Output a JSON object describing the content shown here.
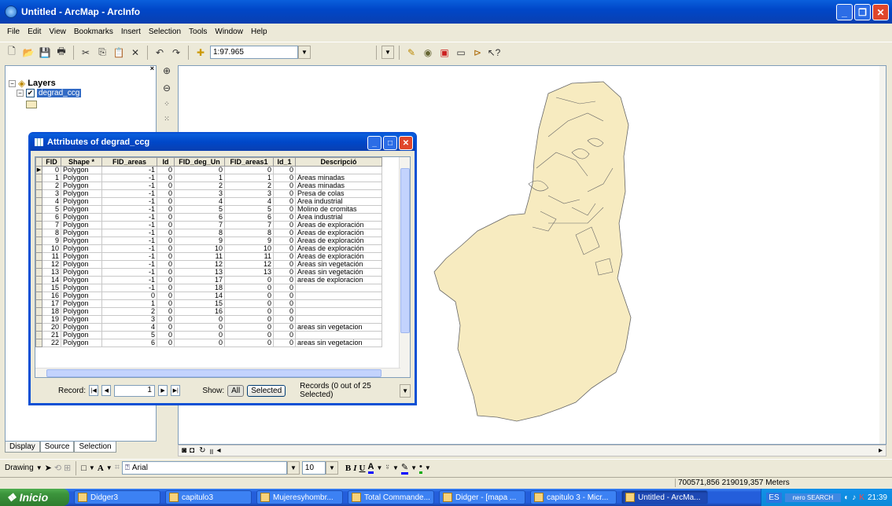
{
  "window": {
    "title": "Untitled - ArcMap - ArcInfo"
  },
  "menu": [
    "File",
    "Edit",
    "View",
    "Bookmarks",
    "Insert",
    "Selection",
    "Tools",
    "Window",
    "Help"
  ],
  "toolbar": {
    "scale": "1:97.965"
  },
  "toc": {
    "layers_label": "Layers",
    "layer_name": "degrad_ccg"
  },
  "toc_tabs": [
    "Display",
    "Source",
    "Selection"
  ],
  "attributes": {
    "title": "Attributes of degrad_ccg",
    "columns": [
      "FID",
      "Shape *",
      "FID_areas",
      "Id",
      "FID_deg_Un",
      "FID_areas1",
      "Id_1",
      "Descripció"
    ],
    "rows": [
      [
        "0",
        "Polygon",
        "-1",
        "0",
        "0",
        "0",
        "0",
        ""
      ],
      [
        "1",
        "Polygon",
        "-1",
        "0",
        "1",
        "1",
        "0",
        "Areas minadas"
      ],
      [
        "2",
        "Polygon",
        "-1",
        "0",
        "2",
        "2",
        "0",
        "Areas minadas"
      ],
      [
        "3",
        "Polygon",
        "-1",
        "0",
        "3",
        "3",
        "0",
        "Presa de colas"
      ],
      [
        "4",
        "Polygon",
        "-1",
        "0",
        "4",
        "4",
        "0",
        "Area industrial"
      ],
      [
        "5",
        "Polygon",
        "-1",
        "0",
        "5",
        "5",
        "0",
        "Molino de cromitas"
      ],
      [
        "6",
        "Polygon",
        "-1",
        "0",
        "6",
        "6",
        "0",
        "Area industrial"
      ],
      [
        "7",
        "Polygon",
        "-1",
        "0",
        "7",
        "7",
        "0",
        "Areas de exploración"
      ],
      [
        "8",
        "Polygon",
        "-1",
        "0",
        "8",
        "8",
        "0",
        "Areas de exploración"
      ],
      [
        "9",
        "Polygon",
        "-1",
        "0",
        "9",
        "9",
        "0",
        "Areas de exploración"
      ],
      [
        "10",
        "Polygon",
        "-1",
        "0",
        "10",
        "10",
        "0",
        "Areas de exploración"
      ],
      [
        "11",
        "Polygon",
        "-1",
        "0",
        "11",
        "11",
        "0",
        "Areas de exploración"
      ],
      [
        "12",
        "Polygon",
        "-1",
        "0",
        "12",
        "12",
        "0",
        "Areas sin vegetación"
      ],
      [
        "13",
        "Polygon",
        "-1",
        "0",
        "13",
        "13",
        "0",
        "Areas sin vegetación"
      ],
      [
        "14",
        "Polygon",
        "-1",
        "0",
        "17",
        "0",
        "0",
        "areas de exploracion"
      ],
      [
        "15",
        "Polygon",
        "-1",
        "0",
        "18",
        "0",
        "0",
        ""
      ],
      [
        "16",
        "Polygon",
        "0",
        "0",
        "14",
        "0",
        "0",
        ""
      ],
      [
        "17",
        "Polygon",
        "1",
        "0",
        "15",
        "0",
        "0",
        ""
      ],
      [
        "18",
        "Polygon",
        "2",
        "0",
        "16",
        "0",
        "0",
        ""
      ],
      [
        "19",
        "Polygon",
        "3",
        "0",
        "0",
        "0",
        "0",
        ""
      ],
      [
        "20",
        "Polygon",
        "4",
        "0",
        "0",
        "0",
        "0",
        "areas sin vegetacion"
      ],
      [
        "21",
        "Polygon",
        "5",
        "0",
        "0",
        "0",
        "0",
        ""
      ],
      [
        "22",
        "Polygon",
        "6",
        "0",
        "0",
        "0",
        "0",
        "areas sin vegetacion"
      ]
    ],
    "record_label": "Record:",
    "record_value": "1",
    "show_label": "Show:",
    "all_label": "All",
    "selected_label": "Selected",
    "records_summary": "Records (0 out of 25 Selected)"
  },
  "drawing": {
    "label": "Drawing",
    "font": "Arial",
    "size": "10"
  },
  "status": {
    "coords": "700571,856 219019,357 Meters"
  },
  "taskbar": {
    "start": "Inicio",
    "tasks": [
      "Didger3",
      "capitulo3",
      "Mujeresyhombr...",
      "Total Commande...",
      "Didger - [mapa ...",
      "capitulo 3 - Micr...",
      "Untitled - ArcMa..."
    ],
    "lang": "ES",
    "nero": "nero SEARCH",
    "time": "21:39"
  },
  "colors": {
    "polygon_fill": "#f7ebc0",
    "titlebar": "#0a50d4"
  }
}
